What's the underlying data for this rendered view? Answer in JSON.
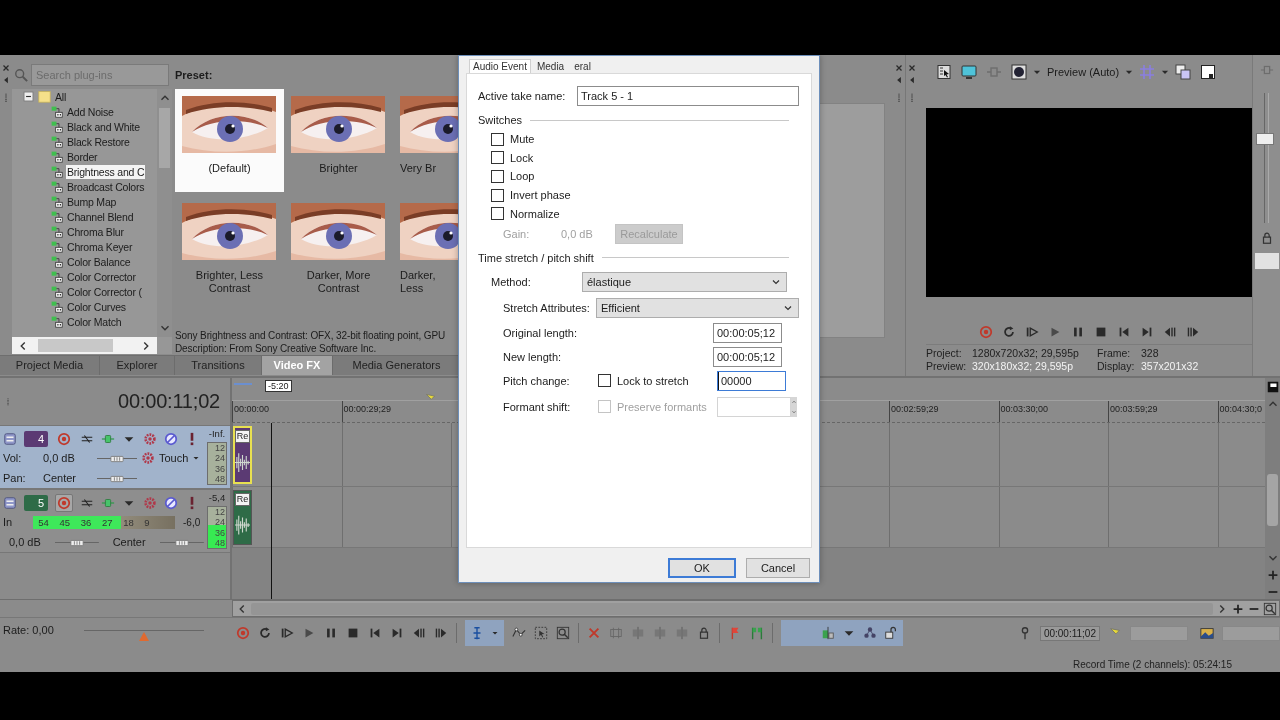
{
  "plugin_panel": {
    "search": {
      "placeholder": "Search plug-ins"
    },
    "tree": {
      "label": "All",
      "expanded": true,
      "children": [
        {
          "label": "Add Noise",
          "selected": false
        },
        {
          "label": "Black and White",
          "selected": false
        },
        {
          "label": "Black Restore",
          "selected": false
        },
        {
          "label": "Border",
          "selected": false
        },
        {
          "label": "Brightness and C",
          "selected": true
        },
        {
          "label": "Broadcast Colors",
          "selected": false
        },
        {
          "label": "Bump Map",
          "selected": false
        },
        {
          "label": "Channel Blend",
          "selected": false
        },
        {
          "label": "Chroma Blur",
          "selected": false
        },
        {
          "label": "Chroma Keyer",
          "selected": false
        },
        {
          "label": "Color Balance",
          "selected": false
        },
        {
          "label": "Color Corrector",
          "selected": false
        },
        {
          "label": "Color Corrector (",
          "selected": false
        },
        {
          "label": "Color Curves",
          "selected": false
        },
        {
          "label": "Color Match",
          "selected": false
        }
      ]
    },
    "preset_heading": "Preset:",
    "presets": [
      {
        "label": "(Default)",
        "selected": true
      },
      {
        "label": "Brighter",
        "selected": false
      },
      {
        "label": "Very Br",
        "selected": false
      },
      {
        "label": "Brighter, Less Contrast",
        "selected": false
      },
      {
        "label": "Darker, More Contrast",
        "selected": false
      },
      {
        "label": "Darker, Less",
        "selected": false
      }
    ],
    "description": [
      "Sony Brightness and Contrast: OFX, 32-bit floating point, GPU",
      "Description: From Sony Creative Software Inc."
    ],
    "tabs": [
      {
        "label": "Project Media",
        "selected": false
      },
      {
        "label": "Explorer",
        "selected": false
      },
      {
        "label": "Transitions",
        "selected": false
      },
      {
        "label": "Video FX",
        "selected": true
      },
      {
        "label": "Media Generators",
        "selected": false
      }
    ]
  },
  "preview": {
    "mode": "Preview (Auto)",
    "zoom_slider": {
      "level": 0.65
    },
    "info": [
      {
        "label": "Project:",
        "value": "1280x720x32; 29,595p"
      },
      {
        "label": "Frame:",
        "value": "328"
      },
      {
        "label": "Preview:",
        "value": "320x180x32; 29,595p"
      },
      {
        "label": "Display:",
        "value": "357x201x32"
      }
    ]
  },
  "timeline": {
    "time": "00:00:11;02",
    "cursor_offset": "-5:20",
    "ruler_left": [
      "00:00:00",
      "00:00:29;29"
    ],
    "ruler_right": [
      "00:02:59;29",
      "00:03:30;00",
      "00:03:59;29",
      "00:04:30;0"
    ],
    "tracks": [
      {
        "kind": "mix",
        "number": "4",
        "color": "#5b3a73",
        "selected": true,
        "armed": false,
        "peak": "-Inf.",
        "meter": {
          "level": 0,
          "ticks": [
            "12",
            "24",
            "36",
            "48"
          ]
        },
        "volume_label": "Vol:",
        "volume": "0,0 dB",
        "pan_label": "Pan:",
        "pan": "Center",
        "automation": "Touch",
        "clip": {
          "label": "Re",
          "selected": true
        }
      },
      {
        "kind": "input",
        "number": "5",
        "color": "#2e6b47",
        "selected": false,
        "armed": true,
        "peak": "-5,4",
        "meter": {
          "level": 0.55,
          "ticks": [
            "12",
            "24",
            "36",
            "48"
          ]
        },
        "input_label": "In",
        "input_meter": {
          "level": 0.62,
          "labels": [
            "54",
            "45",
            "36",
            "27",
            "18",
            "9"
          ],
          "peak": "-6,0"
        },
        "volume": "0,0 dB",
        "pan": "Center",
        "clip": {
          "label": "Re",
          "selected": false
        }
      }
    ]
  },
  "transport": {
    "rate": "Rate: 0,00",
    "rate_slider": {
      "level": 0.5
    },
    "time": "00:00:11;02"
  },
  "status_bar": "Record Time (2 channels): 05:24:15",
  "dialog": {
    "tabs": [
      {
        "label": "Audio Event",
        "selected": true
      },
      {
        "label": "Media",
        "selected": false
      },
      {
        "label": "eral",
        "selected": false
      }
    ],
    "take_name": {
      "label": "Active take name:",
      "value": "Track 5 - 1"
    },
    "switches": {
      "title": "Switches",
      "items": [
        {
          "label": "Mute",
          "checked": false
        },
        {
          "label": "Lock",
          "checked": false
        },
        {
          "label": "Loop",
          "checked": false
        },
        {
          "label": "Invert phase",
          "checked": false
        },
        {
          "label": "Normalize",
          "checked": false
        }
      ]
    },
    "gain": {
      "label": "Gain:",
      "value": "0,0 dB",
      "disabled": true
    },
    "recalculate": {
      "label": "Recalculate",
      "disabled": true
    },
    "stretch": {
      "title": "Time stretch / pitch shift",
      "method": {
        "label": "Method:",
        "value": "élastique"
      },
      "attributes": {
        "label": "Stretch Attributes:",
        "value": "Efficient"
      },
      "original_length": {
        "label": "Original length:",
        "value": "00:00:05;12"
      },
      "new_length": {
        "label": "New length:",
        "value": "00:00:05;12"
      },
      "pitch": {
        "label": "Pitch change:",
        "lock": {
          "label": "Lock to stretch",
          "checked": false
        },
        "value": "00000",
        "focused": true
      },
      "formant": {
        "label": "Formant shift:",
        "preserve": {
          "label": "Preserve formants",
          "checked": false,
          "disabled": true
        },
        "disabled": true
      }
    },
    "buttons": [
      {
        "label": "OK",
        "default": true
      },
      {
        "label": "Cancel",
        "default": false
      }
    ]
  }
}
